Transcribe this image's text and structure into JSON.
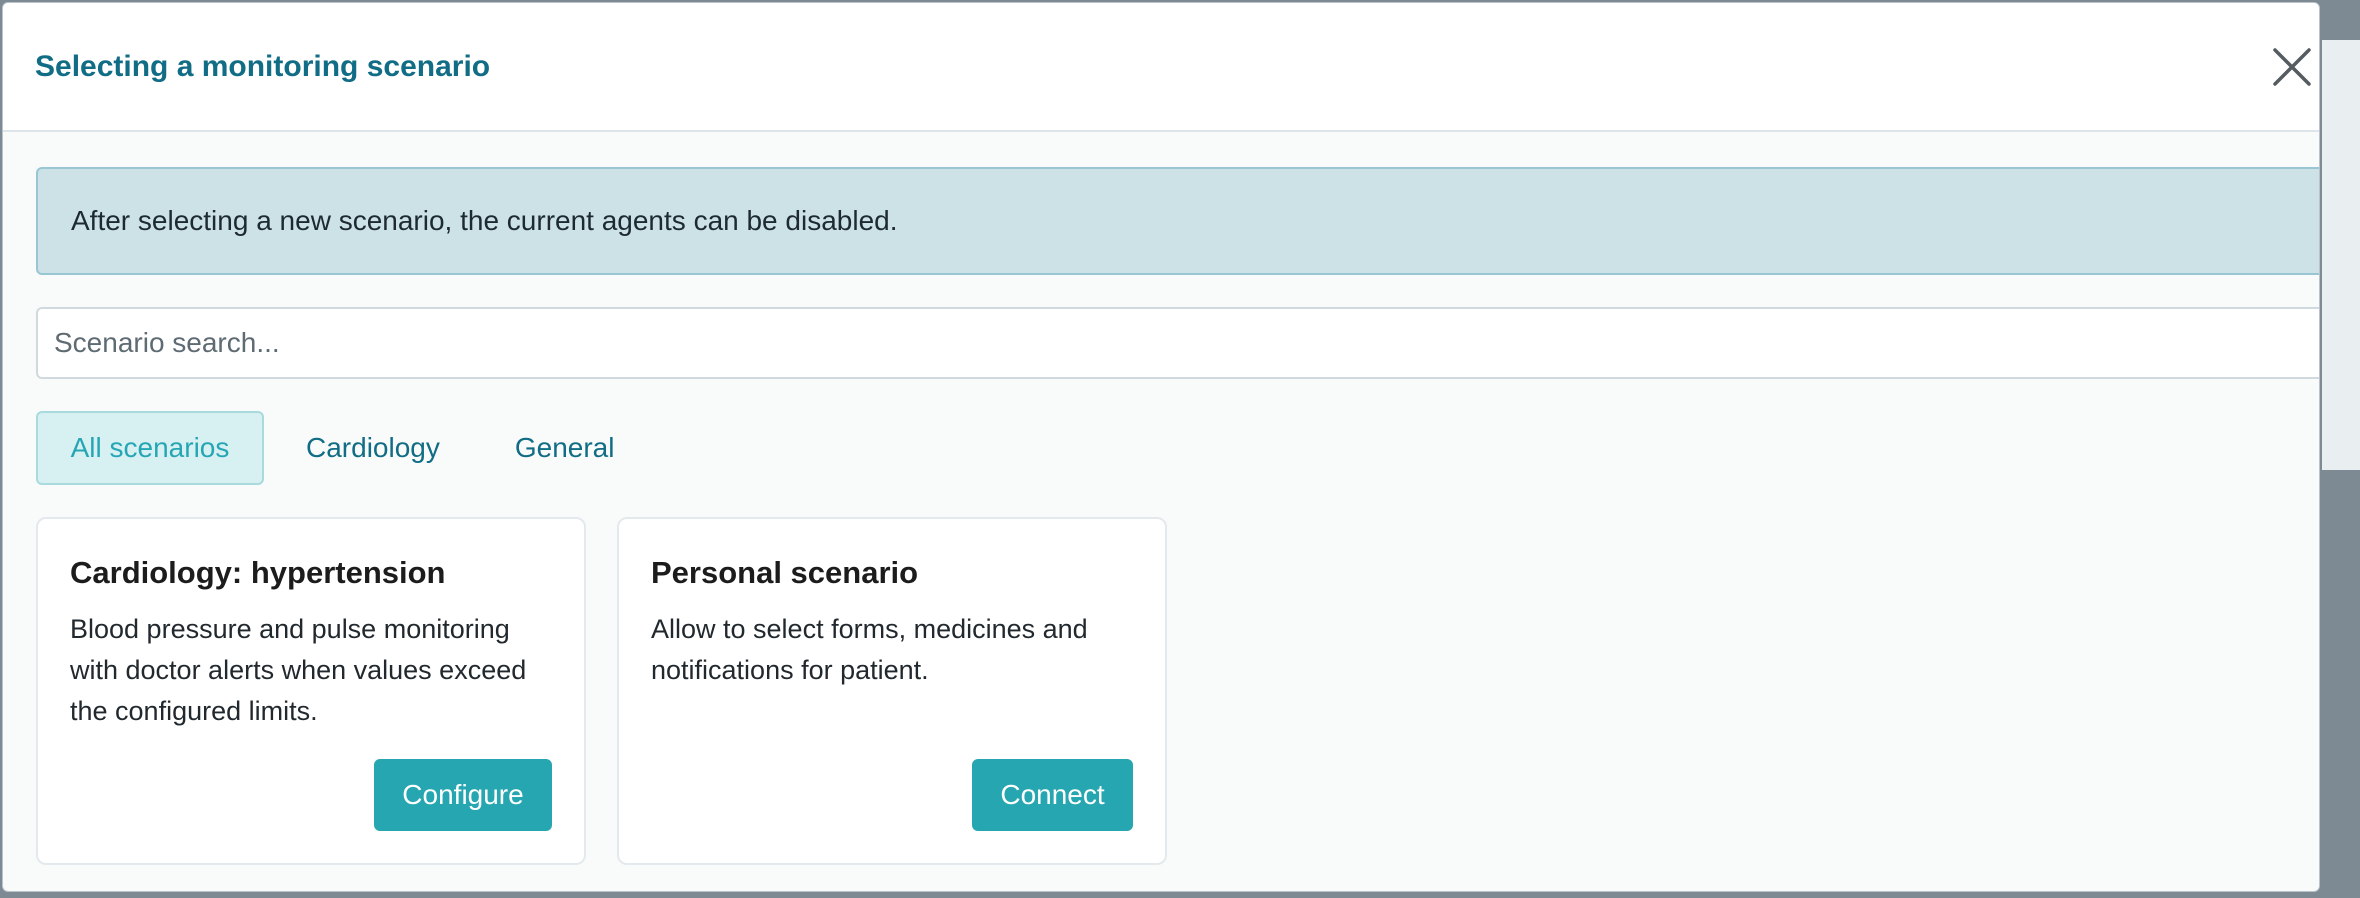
{
  "modal": {
    "title": "Selecting a monitoring scenario",
    "close_icon": "close-icon"
  },
  "alert": {
    "text": "After selecting a new scenario, the current agents can be disabled."
  },
  "search": {
    "placeholder": "Scenario search...",
    "value": ""
  },
  "tabs": [
    {
      "label": "All scenarios",
      "active": true
    },
    {
      "label": "Cardiology",
      "active": false
    },
    {
      "label": "General",
      "active": false
    }
  ],
  "cards": [
    {
      "title": "Cardiology: hypertension",
      "description": "Blood pressure and pulse monitoring with doctor alerts when values exceed the configured limits.",
      "button": "Configure"
    },
    {
      "title": "Personal scenario",
      "description": "Allow to select forms, medicines and notifications for patient.",
      "button": "Connect"
    }
  ],
  "colors": {
    "title": "#116c85",
    "accent": "#26a6b0",
    "alert_bg": "#cde2e7",
    "tab_active_bg": "#d7f0f2"
  }
}
